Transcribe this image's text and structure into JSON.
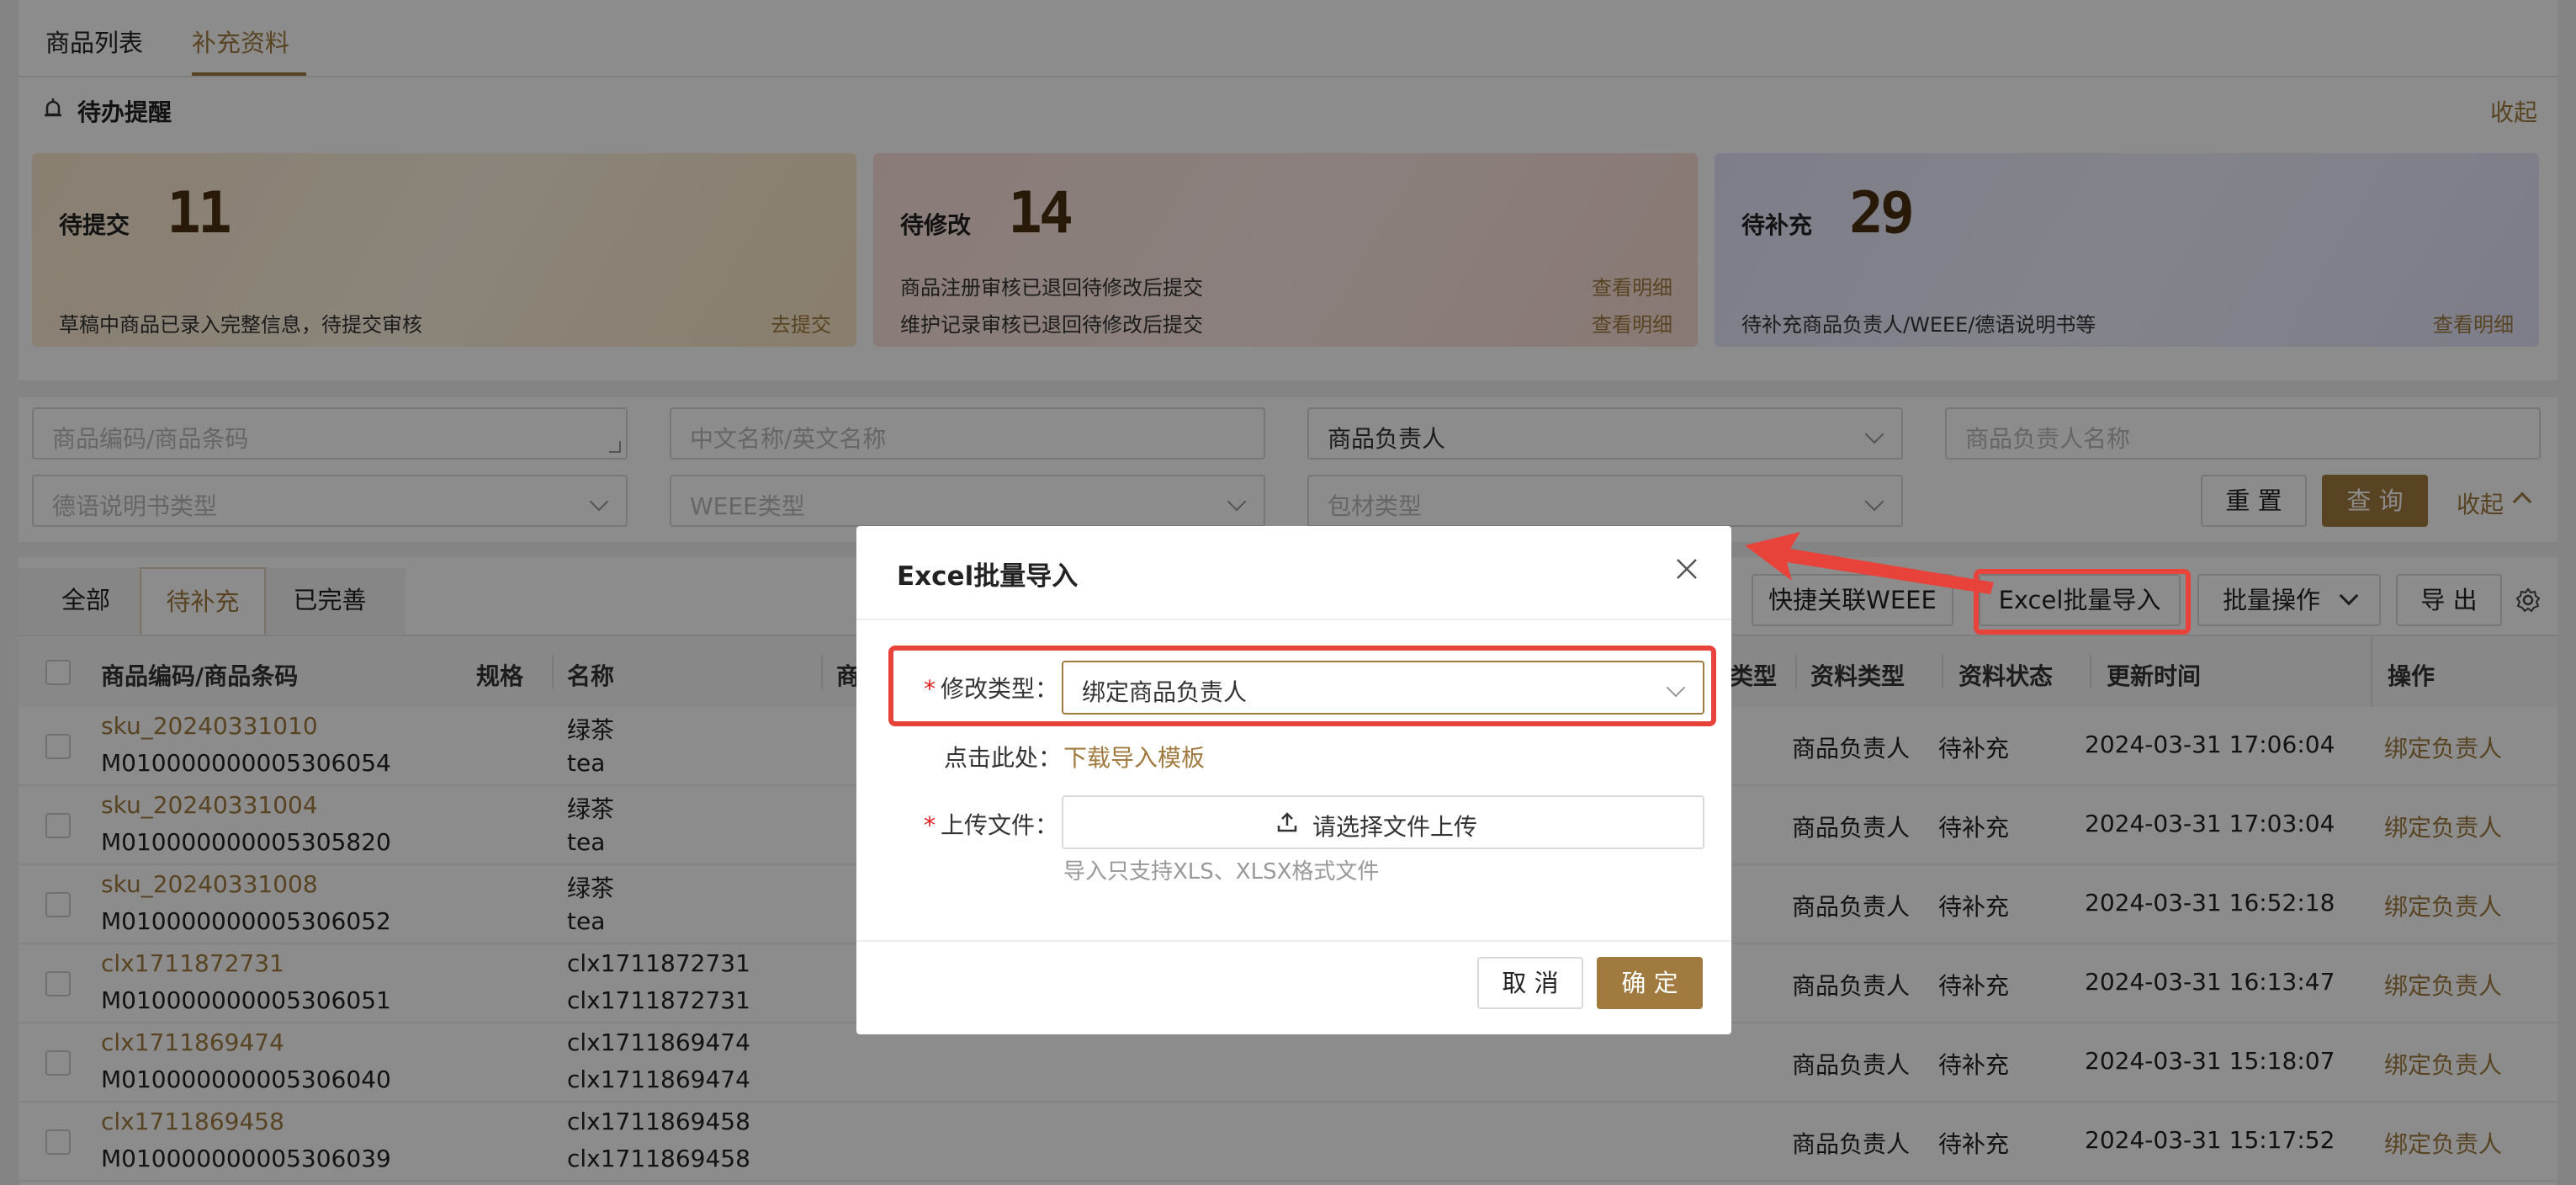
{
  "tabs": [
    {
      "label": "商品列表"
    },
    {
      "label": "补充资料"
    }
  ],
  "reminder": {
    "title": "待办提醒",
    "collapse": "收起",
    "cards": [
      {
        "label": "待提交",
        "count": "11",
        "lines": [
          {
            "text": "草稿中商品已录入完整信息，待提交审核",
            "link": "去提交"
          }
        ]
      },
      {
        "label": "待修改",
        "count": "14",
        "lines": [
          {
            "text": "商品注册审核已退回待修改后提交",
            "link": "查看明细"
          },
          {
            "text": "维护记录审核已退回待修改后提交",
            "link": "查看明细"
          }
        ]
      },
      {
        "label": "待补充",
        "count": "29",
        "lines": [
          {
            "text": "待补充商品负责人/WEEE/德语说明书等",
            "link": "查看明细"
          }
        ]
      }
    ]
  },
  "filter": {
    "code_placeholder": "商品编码/商品条码",
    "name_placeholder": "中文名称/英文名称",
    "owner_select": "商品负责人",
    "owner_name_placeholder": "商品负责人名称",
    "manual_placeholder": "德语说明书类型",
    "weee_placeholder": "WEEE类型",
    "package_placeholder": "包材类型",
    "reset": "重 置",
    "query": "查 询",
    "collapse": "收起"
  },
  "table": {
    "segments": [
      "全部",
      "待补充",
      "已完善"
    ],
    "toolbar": {
      "quick_weee": "快捷关联WEEE",
      "excel_import": "Excel批量导入",
      "batch": "批量操作",
      "export": "导 出"
    },
    "headers": {
      "code": "商品编码/商品条码",
      "spec": "规格",
      "name": "名称",
      "trunc": "商",
      "type_trunc": "类型",
      "data_type": "资料类型",
      "data_status": "资料状态",
      "updated": "更新时间",
      "action": "操作"
    },
    "rows": [
      {
        "sku": "sku_20240331010",
        "code": "M010000000005306054",
        "name_cn": "绿茶",
        "name_en": "tea",
        "data_type": "商品负责人",
        "status": "待补充",
        "time": "2024-03-31 17:06:04",
        "action": "绑定负责人"
      },
      {
        "sku": "sku_20240331004",
        "code": "M010000000005305820",
        "name_cn": "绿茶",
        "name_en": "tea",
        "data_type": "商品负责人",
        "status": "待补充",
        "time": "2024-03-31 17:03:04",
        "action": "绑定负责人"
      },
      {
        "sku": "sku_20240331008",
        "code": "M010000000005306052",
        "name_cn": "绿茶",
        "name_en": "tea",
        "data_type": "商品负责人",
        "status": "待补充",
        "time": "2024-03-31 16:52:18",
        "action": "绑定负责人"
      },
      {
        "sku": "clx1711872731",
        "code": "M010000000005306051",
        "name_cn": "clx1711872731",
        "name_en": "clx1711872731",
        "data_type": "商品负责人",
        "status": "待补充",
        "time": "2024-03-31 16:13:47",
        "action": "绑定负责人"
      },
      {
        "sku": "clx1711869474",
        "code": "M010000000005306040",
        "name_cn": "clx1711869474",
        "name_en": "clx1711869474",
        "data_type": "商品负责人",
        "status": "待补充",
        "time": "2024-03-31 15:18:07",
        "action": "绑定负责人"
      },
      {
        "sku": "clx1711869458",
        "code": "M010000000005306039",
        "name_cn": "clx1711869458",
        "name_en": "clx1711869458",
        "data_type": "商品负责人",
        "status": "待补充",
        "time": "2024-03-31 15:17:52",
        "action": "绑定负责人"
      }
    ]
  },
  "modal": {
    "title": "Excel批量导入",
    "type_label": "修改类型：",
    "type_value": "绑定商品负责人",
    "template_label": "点击此处：",
    "template_link": "下载导入模板",
    "upload_label": "上传文件：",
    "upload_button": "请选择文件上传",
    "upload_hint": "导入只支持XLS、XLSX格式文件",
    "cancel": "取 消",
    "confirm": "确 定"
  },
  "colors": {
    "accent": "#a07a3e",
    "highlight": "#e8433a"
  }
}
